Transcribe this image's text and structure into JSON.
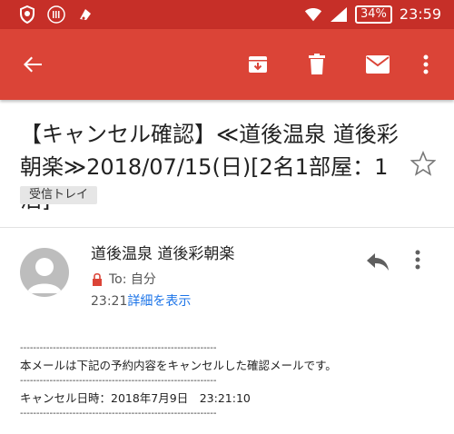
{
  "status_bar": {
    "battery": "34%",
    "time": "23:59"
  },
  "app_bar": {
    "back_icon": "arrow-back-icon",
    "actions": [
      "archive-icon",
      "delete-icon",
      "mail-icon",
      "more-vert-icon"
    ]
  },
  "email": {
    "subject": "【キャンセル確認】≪道後温泉 道後彩朝楽≫2018/07/15(日)[2名1部屋：1泊]",
    "label": "受信トレイ",
    "sender": "道後温泉 道後彩朝楽",
    "to": "To: 自分",
    "time": "23:21",
    "details_link": "詳細を表示",
    "body": {
      "dashes": "------------------------------------------------------------",
      "line1": "本メールは下記の予約内容をキャンセルした確認メールです。",
      "line2": "キャンセル日時：2018年7月9日　23:21:10"
    }
  },
  "colors": {
    "status_bar": "#c62f28",
    "app_bar": "#db4437",
    "link": "#1a73e8"
  }
}
